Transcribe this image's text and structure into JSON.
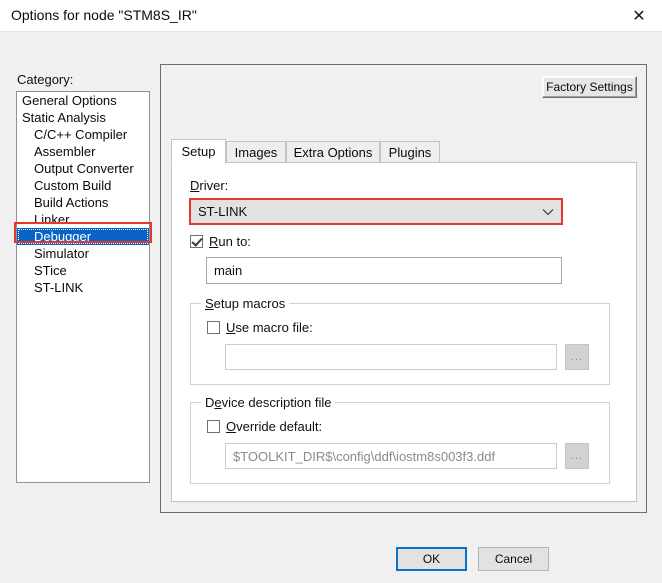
{
  "window": {
    "title": "Options for node \"STM8S_IR\"",
    "close_icon": "close-icon"
  },
  "category": {
    "label": "Category:",
    "items": [
      {
        "label": "General Options",
        "indent": false,
        "selected": false
      },
      {
        "label": "Static Analysis",
        "indent": false,
        "selected": false
      },
      {
        "label": "C/C++ Compiler",
        "indent": true,
        "selected": false
      },
      {
        "label": "Assembler",
        "indent": true,
        "selected": false
      },
      {
        "label": "Output Converter",
        "indent": true,
        "selected": false
      },
      {
        "label": "Custom Build",
        "indent": true,
        "selected": false
      },
      {
        "label": "Build Actions",
        "indent": true,
        "selected": false
      },
      {
        "label": "Linker",
        "indent": true,
        "selected": false
      },
      {
        "label": "Debugger",
        "indent": true,
        "selected": true
      },
      {
        "label": "Simulator",
        "indent": true,
        "selected": false
      },
      {
        "label": "STice",
        "indent": true,
        "selected": false
      },
      {
        "label": "ST-LINK",
        "indent": true,
        "selected": false
      }
    ]
  },
  "panel": {
    "factory_settings_label": "Factory Settings",
    "tabs": [
      {
        "label": "Setup",
        "active": true
      },
      {
        "label": "Images",
        "active": false
      },
      {
        "label": "Extra Options",
        "active": false
      },
      {
        "label": "Plugins",
        "active": false
      }
    ]
  },
  "setup": {
    "driver_label_prefix": "D",
    "driver_label_rest": "river:",
    "driver_value": "ST-LINK",
    "driver_arrow_icon": "chevron-down-icon",
    "run_to_label_prefix": "R",
    "run_to_label_rest": "un to:",
    "run_to_checked": true,
    "run_to_value": "main",
    "setup_macros": {
      "title_prefix": "S",
      "title_rest": "etup macros",
      "use_macro_label_prefix": "U",
      "use_macro_label_rest": "se macro file:",
      "use_macro_checked": false,
      "macro_file_value": "",
      "browse_label": "..."
    },
    "device_description": {
      "title_prefix": "D",
      "title_mid": "e",
      "title_rest": "vice description file",
      "override_label_prefix": "O",
      "override_label_rest": "verride default:",
      "override_checked": false,
      "path_value": "$TOOLKIT_DIR$\\config\\ddf\\iostm8s003f3.ddf",
      "browse_label": "..."
    }
  },
  "footer": {
    "ok_label": "OK",
    "cancel_label": "Cancel"
  },
  "annotations": {
    "highlight_color": "#e8362a"
  }
}
